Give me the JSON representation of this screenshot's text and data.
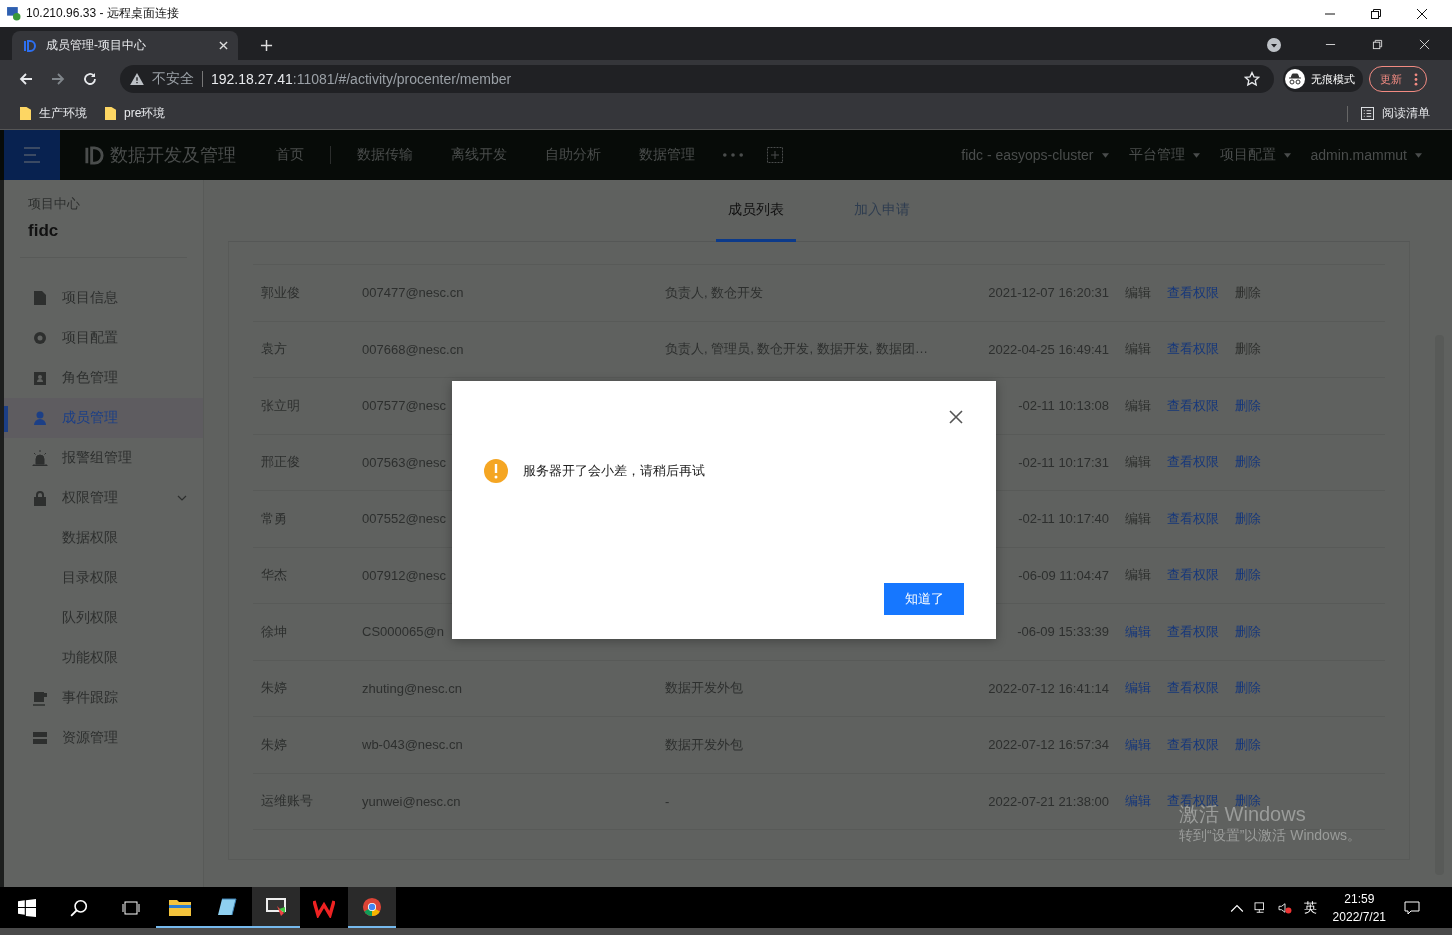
{
  "rdp_window": {
    "title": "10.210.96.33 - 远程桌面连接"
  },
  "browser": {
    "tabs": [
      {
        "title": "成员管理-项目中心",
        "selected": true
      }
    ],
    "address": {
      "warning": "不安全",
      "host": "192.18.27.41",
      "path": ":11081/#/activity/procenter/member"
    },
    "incognito": "无痕模式",
    "update": "更新",
    "bookmarks": [
      "生产环境",
      "pre环境"
    ],
    "reading_list": "阅读清单"
  },
  "app": {
    "logo": "数据开发及管理",
    "nav": [
      "首页",
      "数据传输",
      "离线开发",
      "自助分析",
      "数据管理"
    ],
    "right_menus": [
      "fidc - easyops-cluster",
      "平台管理",
      "项目配置",
      "admin.mammut"
    ]
  },
  "sidebar": {
    "heading": "项目中心",
    "project": "fidc",
    "items": [
      {
        "label": "项目信息",
        "selected": false
      },
      {
        "label": "项目配置",
        "selected": false
      },
      {
        "label": "角色管理",
        "selected": false
      },
      {
        "label": "成员管理",
        "selected": true
      },
      {
        "label": "报警组管理",
        "selected": false
      },
      {
        "label": "权限管理",
        "selected": false,
        "expanded": true,
        "children": [
          {
            "label": "数据权限",
            "selected": false
          },
          {
            "label": "目录权限",
            "selected": false
          },
          {
            "label": "队列权限",
            "selected": false
          },
          {
            "label": "功能权限",
            "selected": false
          }
        ]
      },
      {
        "label": "事件跟踪",
        "selected": false
      },
      {
        "label": "资源管理",
        "selected": false
      }
    ]
  },
  "content_tabs": [
    {
      "label": "成员列表",
      "selected": true
    },
    {
      "label": "加入申请",
      "selected": false
    }
  ],
  "table": {
    "rows": [
      {
        "name": "郭业俊",
        "account": "007477@nesc.cn",
        "roles": "负责人, 数仓开发",
        "modified": "2021-12-07 16:20:31",
        "actions": [
          {
            "label": "编辑",
            "disabled": true
          },
          {
            "label": "查看权限",
            "disabled": false
          },
          {
            "label": "删除",
            "disabled": true
          }
        ]
      },
      {
        "name": "袁方",
        "account": "007668@nesc.cn",
        "roles": "负责人, 管理员, 数仓开发, 数据开发, 数据团…",
        "modified": "2022-04-25 16:49:41",
        "actions": [
          {
            "label": "编辑",
            "disabled": true
          },
          {
            "label": "查看权限",
            "disabled": false
          },
          {
            "label": "删除",
            "disabled": true
          }
        ]
      },
      {
        "name": "张立明",
        "account": "007577@nesc",
        "roles": "",
        "modified": "-02-11 10:13:08",
        "actions": [
          {
            "label": "编辑",
            "disabled": true
          },
          {
            "label": "查看权限",
            "disabled": false
          },
          {
            "label": "删除",
            "disabled": false
          }
        ]
      },
      {
        "name": "邢正俊",
        "account": "007563@nesc",
        "roles": "",
        "modified": "-02-11 10:17:31",
        "actions": [
          {
            "label": "编辑",
            "disabled": true
          },
          {
            "label": "查看权限",
            "disabled": false
          },
          {
            "label": "删除",
            "disabled": false
          }
        ]
      },
      {
        "name": "常勇",
        "account": "007552@nesc",
        "roles": "",
        "modified": "-02-11 10:17:40",
        "actions": [
          {
            "label": "编辑",
            "disabled": true
          },
          {
            "label": "查看权限",
            "disabled": false
          },
          {
            "label": "删除",
            "disabled": false
          }
        ]
      },
      {
        "name": "华杰",
        "account": "007912@nesc",
        "roles": "",
        "modified": "-06-09 11:04:47",
        "actions": [
          {
            "label": "编辑",
            "disabled": true
          },
          {
            "label": "查看权限",
            "disabled": false
          },
          {
            "label": "删除",
            "disabled": false
          }
        ]
      },
      {
        "name": "徐坤",
        "account": "CS000065@n",
        "roles": "",
        "modified": "-06-09 15:33:39",
        "actions": [
          {
            "label": "编辑",
            "disabled": false
          },
          {
            "label": "查看权限",
            "disabled": false
          },
          {
            "label": "删除",
            "disabled": false
          }
        ]
      },
      {
        "name": "朱婷",
        "account": "zhuting@nesc.cn",
        "roles": "数据开发外包",
        "modified": "2022-07-12 16:41:14",
        "actions": [
          {
            "label": "编辑",
            "disabled": false
          },
          {
            "label": "查看权限",
            "disabled": false
          },
          {
            "label": "删除",
            "disabled": false
          }
        ]
      },
      {
        "name": "朱婷",
        "account": "wb-043@nesc.cn",
        "roles": "数据开发外包",
        "modified": "2022-07-12 16:57:34",
        "actions": [
          {
            "label": "编辑",
            "disabled": false
          },
          {
            "label": "查看权限",
            "disabled": false
          },
          {
            "label": "删除",
            "disabled": false
          }
        ]
      },
      {
        "name": "运维账号",
        "account": "yunwei@nesc.cn",
        "roles": "-",
        "modified": "2022-07-21 21:38:00",
        "actions": [
          {
            "label": "编辑",
            "disabled": false
          },
          {
            "label": "查看权限",
            "disabled": false
          },
          {
            "label": "删除",
            "disabled": false
          }
        ]
      }
    ]
  },
  "dialog": {
    "message": "服务器开了会小差，请稍后再试",
    "button": "知道了"
  },
  "activation_notice": {
    "title": "激活 Windows",
    "hint": "转到“设置”以激活 Windows。"
  },
  "taskbar": {
    "ime": "英",
    "time": "21:59",
    "date": "2022/7/21"
  }
}
